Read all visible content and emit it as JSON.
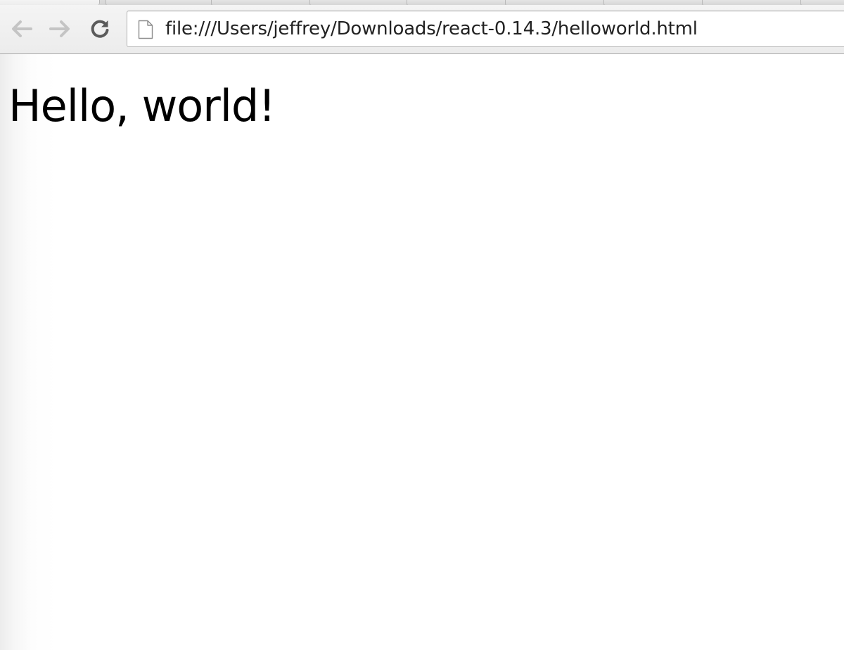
{
  "browser": {
    "address_bar": {
      "url": "file:///Users/jeffrey/Downloads/react-0.14.3/helloworld.html",
      "page_icon": "document-icon"
    },
    "nav": {
      "back_icon": "back-arrow-icon",
      "forward_icon": "forward-arrow-icon",
      "reload_icon": "reload-icon"
    }
  },
  "page": {
    "heading": "Hello, world!"
  },
  "colors": {
    "toolbar_bg": "#f0f0f0",
    "text": "#000000",
    "disabled_icon": "#c4c4c4",
    "active_icon": "#5a5a5a"
  }
}
